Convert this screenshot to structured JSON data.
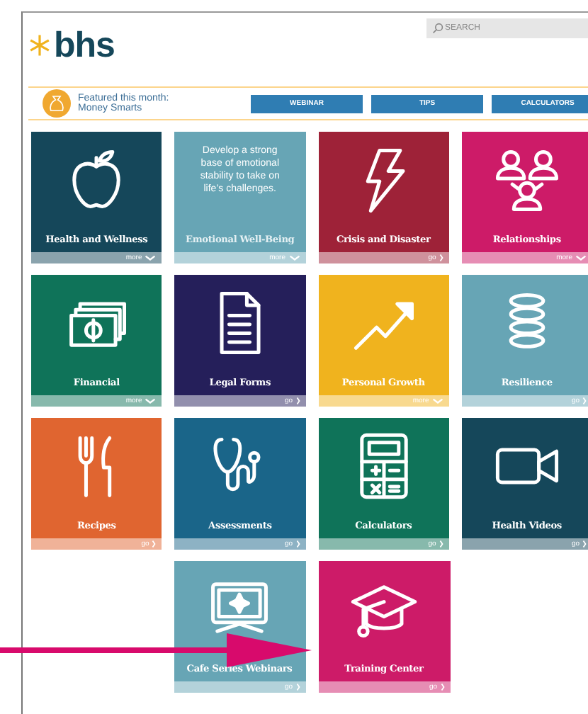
{
  "logo": {
    "text": "bhs"
  },
  "search": {
    "placeholder": "SEARCH"
  },
  "featured": {
    "label": "Featured this month:",
    "topic": "Money Smarts",
    "buttons": [
      "WEBINAR",
      "TIPS",
      "CALCULATORS"
    ]
  },
  "rows": [
    [
      {
        "title": "Health and Wellness",
        "color": "#15475a",
        "link": {
          "kind": "more",
          "label": "more"
        }
      },
      {
        "title": "Emotional Well-Being",
        "color": "#67a5b5",
        "description": "Develop a strong base of emotional stability to take on life’s challenges.",
        "link": {
          "kind": "more",
          "label": "more"
        }
      },
      {
        "title": "Crisis and Disaster",
        "color": "#9e2238",
        "link": {
          "kind": "go",
          "label": "go"
        }
      },
      {
        "title": "Relationships",
        "color": "#cd1b68",
        "link": {
          "kind": "more",
          "label": "more"
        }
      }
    ],
    [
      {
        "title": "Financial",
        "color": "#0f7359",
        "link": {
          "kind": "more",
          "label": "more"
        }
      },
      {
        "title": "Legal Forms",
        "color": "#251f5a",
        "link": {
          "kind": "go",
          "label": "go"
        }
      },
      {
        "title": "Personal Growth",
        "color": "#f0b31e",
        "link": {
          "kind": "more",
          "label": "more"
        }
      },
      {
        "title": "Resilience",
        "color": "#67a5b5",
        "link": {
          "kind": "go",
          "label": "go"
        }
      }
    ],
    [
      {
        "title": "Recipes",
        "color": "#e06530",
        "link": {
          "kind": "go",
          "label": "go"
        }
      },
      {
        "title": "Assessments",
        "color": "#1a6589",
        "link": {
          "kind": "go",
          "label": "go"
        }
      },
      {
        "title": "Calculators",
        "color": "#0f7359",
        "link": {
          "kind": "go",
          "label": "go"
        }
      },
      {
        "title": "Health Videos",
        "color": "#15475a",
        "link": {
          "kind": "go",
          "label": "go"
        }
      }
    ],
    [
      {
        "title": "Cafe Series Webinars",
        "color": "#67a5b5",
        "link": {
          "kind": "go",
          "label": "go"
        }
      },
      {
        "title": "Training Center",
        "color": "#cd1b68",
        "link": {
          "kind": "go",
          "label": "go"
        }
      }
    ]
  ]
}
